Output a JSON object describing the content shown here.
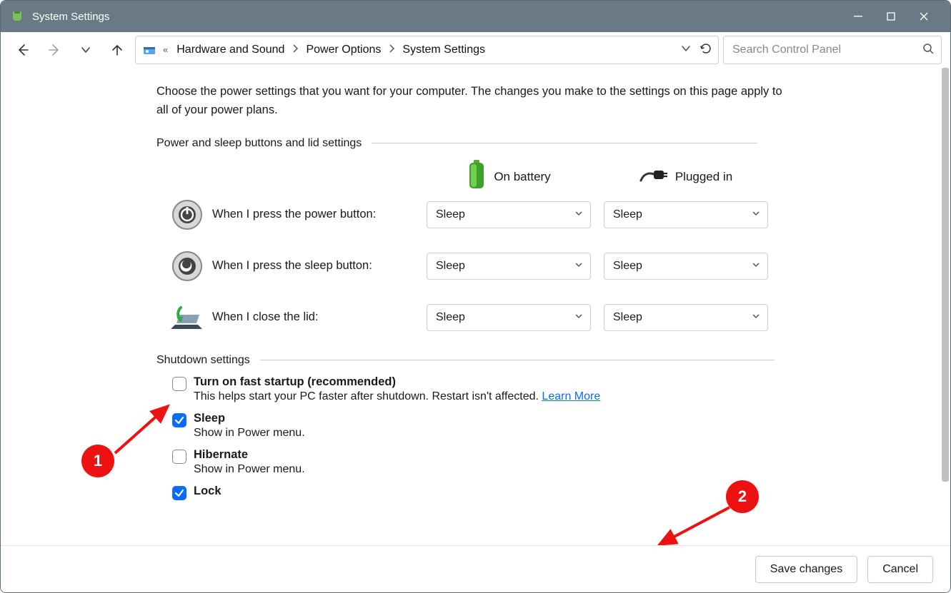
{
  "window": {
    "title": "System Settings"
  },
  "breadcrumb": {
    "items": [
      "Hardware and Sound",
      "Power Options",
      "System Settings"
    ]
  },
  "search": {
    "placeholder": "Search Control Panel"
  },
  "intro": "Choose the power settings that you want for your computer. The changes you make to the settings on this page apply to all of your power plans.",
  "section1": {
    "title": "Power and sleep buttons and lid settings",
    "col_battery": "On battery",
    "col_plugged": "Plugged in",
    "rows": [
      {
        "label": "When I press the power button:",
        "battery": "Sleep",
        "plugged": "Sleep"
      },
      {
        "label": "When I press the sleep button:",
        "battery": "Sleep",
        "plugged": "Sleep"
      },
      {
        "label": "When I close the lid:",
        "battery": "Sleep",
        "plugged": "Sleep"
      }
    ]
  },
  "section2": {
    "title": "Shutdown settings",
    "items": [
      {
        "title": "Turn on fast startup (recommended)",
        "desc": "This helps start your PC faster after shutdown. Restart isn't affected. ",
        "link": "Learn More",
        "checked": false
      },
      {
        "title": "Sleep",
        "desc": "Show in Power menu.",
        "checked": true
      },
      {
        "title": "Hibernate",
        "desc": "Show in Power menu.",
        "checked": false
      },
      {
        "title": "Lock",
        "desc": "",
        "checked": true
      }
    ]
  },
  "footer": {
    "save": "Save changes",
    "cancel": "Cancel"
  },
  "annotations": {
    "one": "1",
    "two": "2"
  }
}
